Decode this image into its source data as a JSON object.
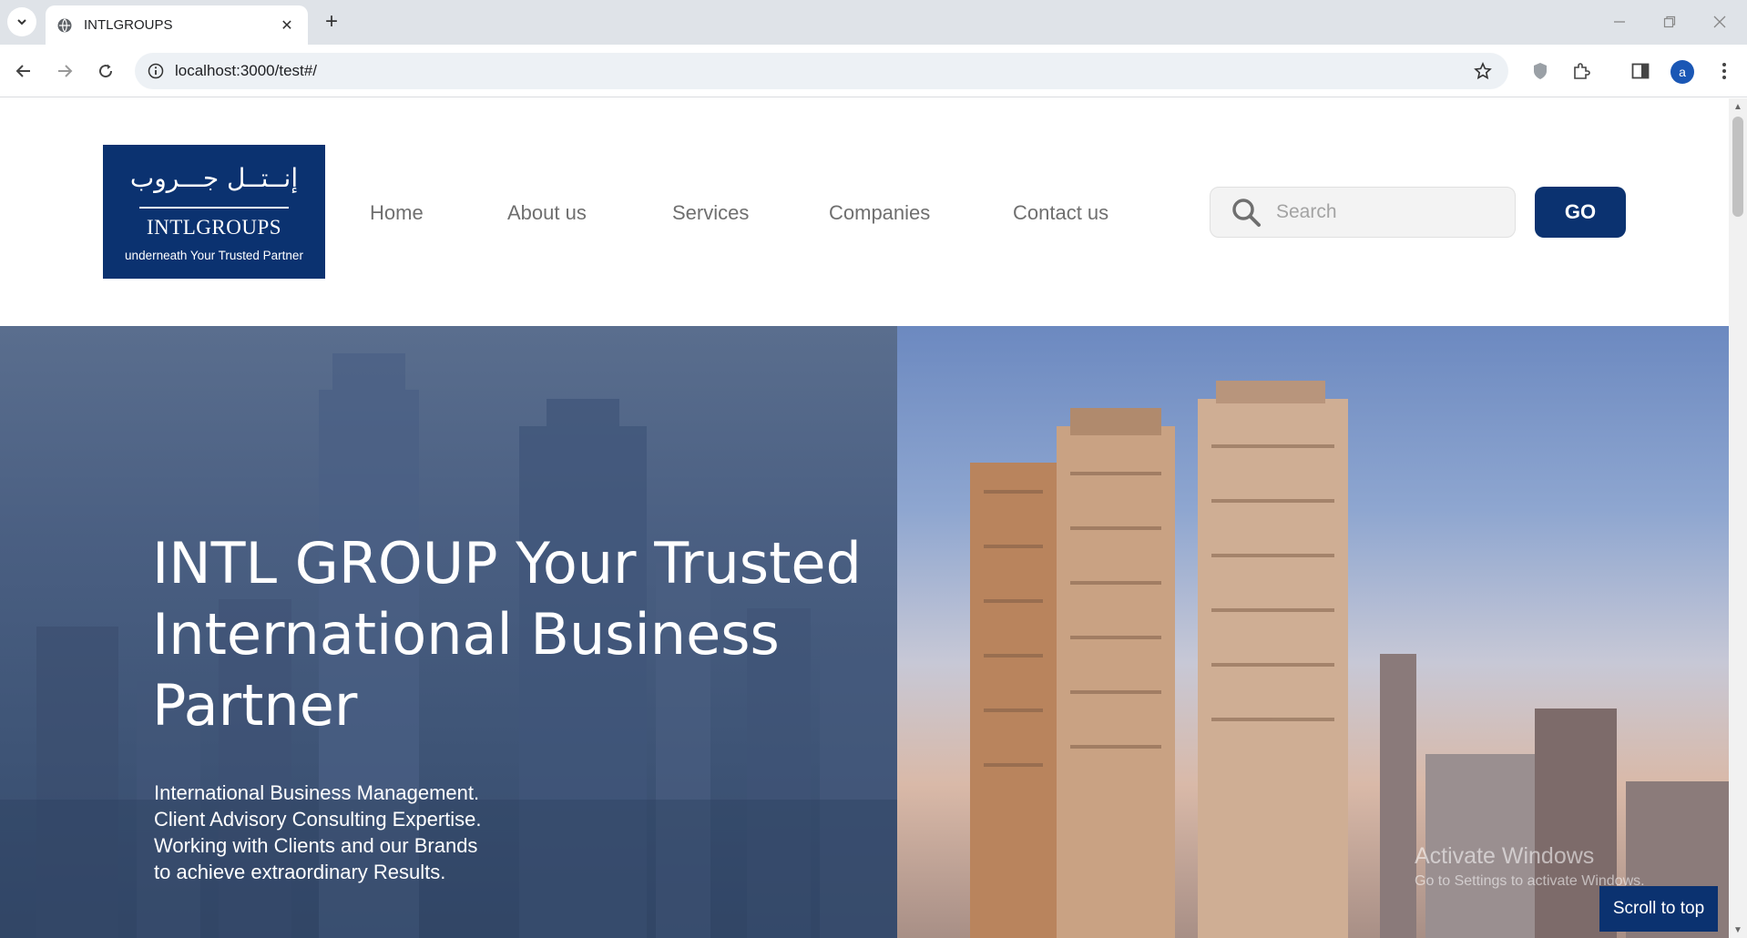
{
  "browser": {
    "tab_title": "INTLGROUPS",
    "url": "localhost:3000/test#/",
    "profile_initial": "a"
  },
  "header": {
    "logo": {
      "arabic": "إنــتــل جـــروب",
      "name": "INTLGROUPS",
      "tagline": "underneath Your Trusted Partner"
    },
    "nav": [
      "Home",
      "About us",
      "Services",
      "Companies",
      "Contact us"
    ],
    "search_placeholder": "Search",
    "go_label": "GO"
  },
  "hero": {
    "title": "INTL GROUP Your Trusted International Business Partner",
    "subtitle_lines": [
      "International Business Management.",
      "Client Advisory Consulting Expertise.",
      "Working with Clients and our Brands",
      "to achieve extraordinary Results."
    ]
  },
  "watermark": {
    "line1": "Activate Windows",
    "line2": "Go to Settings to activate Windows."
  },
  "scroll_to_top_label": "Scroll to top",
  "colors": {
    "brand_navy": "#0b3270",
    "nav_text": "#6f6f6f"
  }
}
